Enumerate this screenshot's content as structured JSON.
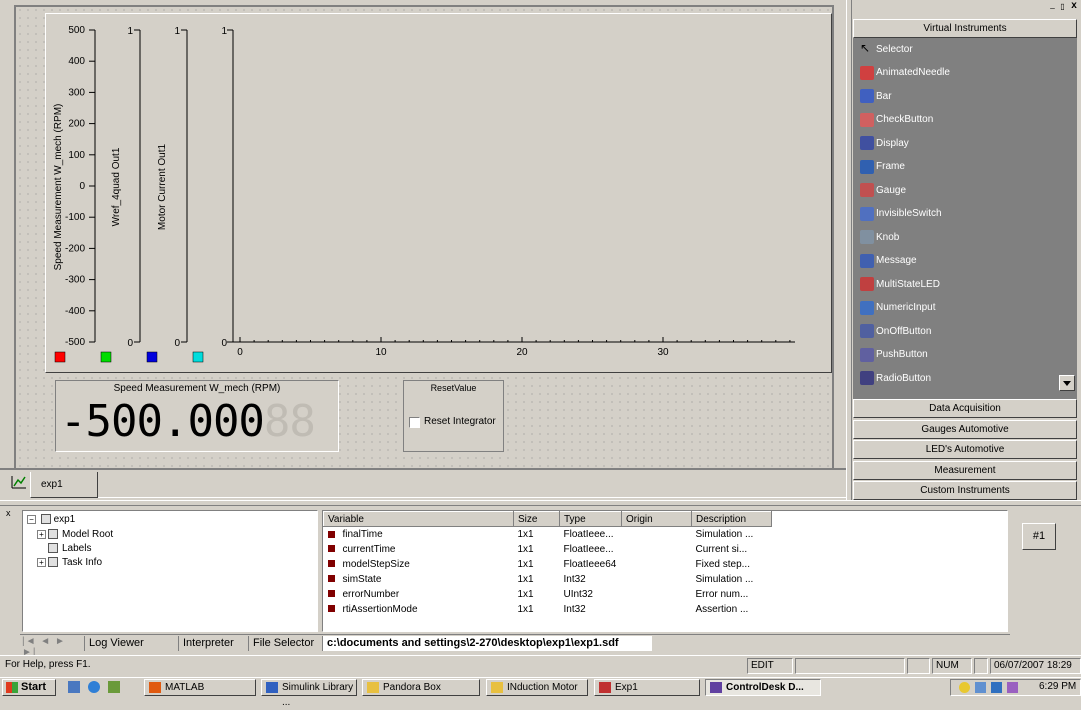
{
  "window": {
    "min_btn": "_",
    "max_btn": "▯",
    "close_btn": "x"
  },
  "plot": {
    "ytitles": [
      "Speed Measurement W_mech (RPM)",
      "Wref_4quad Out1",
      "Motor Current Out1"
    ],
    "yticks_main": [
      "500",
      "400",
      "300",
      "200",
      "100",
      "0",
      "-100",
      "-200",
      "-300",
      "-400",
      "-500"
    ],
    "aux_top": "1",
    "aux_bottom": "0",
    "xticks": [
      "0",
      "10",
      "20",
      "30"
    ],
    "legend_colors": [
      "#ff0000",
      "#00dd00",
      "#0000dd",
      "#00dddd"
    ]
  },
  "display": {
    "title": "Speed Measurement W_mech (RPM)",
    "value": "-500.000",
    "ghost": "88"
  },
  "reset": {
    "title": "ResetValue",
    "checkbox_label": "Reset Integrator",
    "checked": false
  },
  "doc_tab": {
    "label": "exp1"
  },
  "palette": {
    "header": "Virtual Instruments",
    "tools": [
      "Selector",
      "AnimatedNeedle",
      "Bar",
      "CheckButton",
      "Display",
      "Frame",
      "Gauge",
      "InvisibleSwitch",
      "Knob",
      "Message",
      "MultiStateLED",
      "NumericInput",
      "OnOffButton",
      "PushButton",
      "RadioButton"
    ],
    "groups": [
      "Data Acquisition",
      "Gauges Automotive",
      "LED's Automotive",
      "Measurement",
      "Custom Instruments"
    ]
  },
  "tree": {
    "root": "exp1",
    "children": [
      "Model Root",
      "Labels",
      "Task Info"
    ]
  },
  "vars": {
    "columns": [
      "Variable",
      "Size",
      "Type",
      "Origin",
      "Description"
    ],
    "rows": [
      [
        "finalTime",
        "1x1",
        "FloatIeee...",
        "",
        "Simulation ..."
      ],
      [
        "currentTime",
        "1x1",
        "FloatIeee...",
        "",
        "Current si..."
      ],
      [
        "modelStepSize",
        "1x1",
        "FloatIeee64",
        "",
        "Fixed step..."
      ],
      [
        "simState",
        "1x1",
        "Int32",
        "",
        "Simulation ..."
      ],
      [
        "errorNumber",
        "1x1",
        "UInt32",
        "",
        "Error num..."
      ],
      [
        "rtiAssertionMode",
        "1x1",
        "Int32",
        "",
        "Assertion ..."
      ]
    ]
  },
  "hash_button": "#1",
  "bottom_tabs": [
    "Log Viewer",
    "Interpreter",
    "File Selector",
    "c:\\documents and settings\\2-270\\desktop\\exp1\\exp1.sdf"
  ],
  "status": {
    "help": "For Help, press F1.",
    "mode": "EDIT",
    "num": "NUM",
    "datetime": "06/07/2007 18:29"
  },
  "taskbar": {
    "start": "Start",
    "tasks": [
      "MATLAB",
      "Simulink Library ...",
      "Pandora Box",
      "INduction Motor",
      "Exp1",
      "ControlDesk D..."
    ],
    "clock": "6:29 PM"
  }
}
